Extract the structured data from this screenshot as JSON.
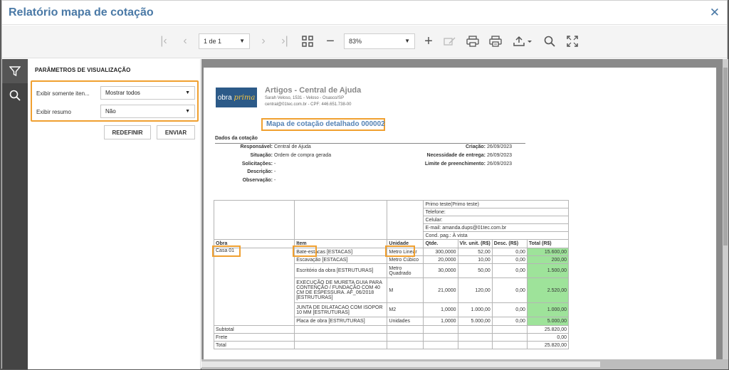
{
  "window": {
    "title": "Relatório mapa de cotação"
  },
  "toolbar": {
    "page_select": "1 de 1",
    "zoom": "83%"
  },
  "panel": {
    "title": "PARÂMETROS DE VISUALIZAÇÃO",
    "params": [
      {
        "label": "Exibir somente iten...",
        "value": "Mostrar todos"
      },
      {
        "label": "Exibir resumo",
        "value": "Não"
      }
    ],
    "buttons": {
      "reset": "REDEFINIR",
      "send": "ENVIAR"
    }
  },
  "report": {
    "logo_text_1": "obra",
    "logo_text_2": "prima",
    "company": "Artigos - Central de Ajuda",
    "company_line_1": "Sarah Veloso, 1531 - Veloso - Osasco/SP",
    "company_line_2": "central@01tec.com.br  - CPF: 446.651.738-00",
    "doc_title": "Mapa de cotação detalhado 000002",
    "section": "Dados da cotação",
    "fields_left": [
      {
        "label": "Responsável:",
        "value": "Central de Ajuda"
      },
      {
        "label": "Situação:",
        "value": "Ordem de compra gerada"
      },
      {
        "label": "Solicitações:",
        "value": "-"
      },
      {
        "label": "Descrição:",
        "value": "-"
      },
      {
        "label": "Observação:",
        "value": "-"
      }
    ],
    "fields_right": [
      {
        "label": "Criação:",
        "value": "26/09/2023"
      },
      {
        "label": "Necessidade de entrega:",
        "value": "26/09/2023"
      },
      {
        "label": "Limite de preenchimento:",
        "value": "26/09/2023"
      }
    ],
    "supplier": {
      "name": "Primo teste(Primo teste)",
      "phone": "Telefone:",
      "cell": "Celular:",
      "email": "E-mail: amanda.dups@01tec.com.br",
      "payment": "Cond. pag.: À vista"
    },
    "columns": {
      "obra": "Obra",
      "item": "Item",
      "unit": "Unidade",
      "qty": "Qtde.",
      "unit_price": "Vlr. unit. (R$)",
      "discount": "Desc. (R$)",
      "total": "Total (R$)"
    },
    "obra_name": "Casa 01",
    "rows": [
      {
        "item": "Bate-estacas [ESTACAS]",
        "unit": "Metro Linear",
        "qty": "300,0000",
        "unit_price": "52,00",
        "discount": "0,00",
        "total": "15.600,00"
      },
      {
        "item": "Escavação [ESTACAS]",
        "unit": "Metro Cúbico",
        "qty": "20,0000",
        "unit_price": "10,00",
        "discount": "0,00",
        "total": "200,00"
      },
      {
        "item": "Escritório da obra [ESTRUTURAS]",
        "unit": "Metro Quadrado",
        "qty": "30,0000",
        "unit_price": "50,00",
        "discount": "0,00",
        "total": "1.500,00"
      },
      {
        "item": "EXECUÇÃO DE MURETA GUIA PARA CONTENÇÃO / FUNDAÇÃO COM 40 CM DE ESPESSURA. AF_06/2018 [ESTRUTURAS]",
        "unit": "M",
        "qty": "21,0000",
        "unit_price": "120,00",
        "discount": "0,00",
        "total": "2.520,00"
      },
      {
        "item": "JUNTA DE DILATACAO COM ISOPOR 10 MM [ESTRUTURAS]",
        "unit": "M2",
        "qty": "1,0000",
        "unit_price": "1.000,00",
        "discount": "0,00",
        "total": "1.000,00"
      },
      {
        "item": "Placa de obra [ESTRUTURAS]",
        "unit": "Unidades",
        "qty": "1,0000",
        "unit_price": "5.000,00",
        "discount": "0,00",
        "total": "5.000,00"
      }
    ],
    "summary": [
      {
        "label": "Subtotal",
        "value": "25.820,00"
      },
      {
        "label": "Frete",
        "value": "0,00"
      },
      {
        "label": "Total",
        "value": "25.820,00"
      }
    ]
  }
}
